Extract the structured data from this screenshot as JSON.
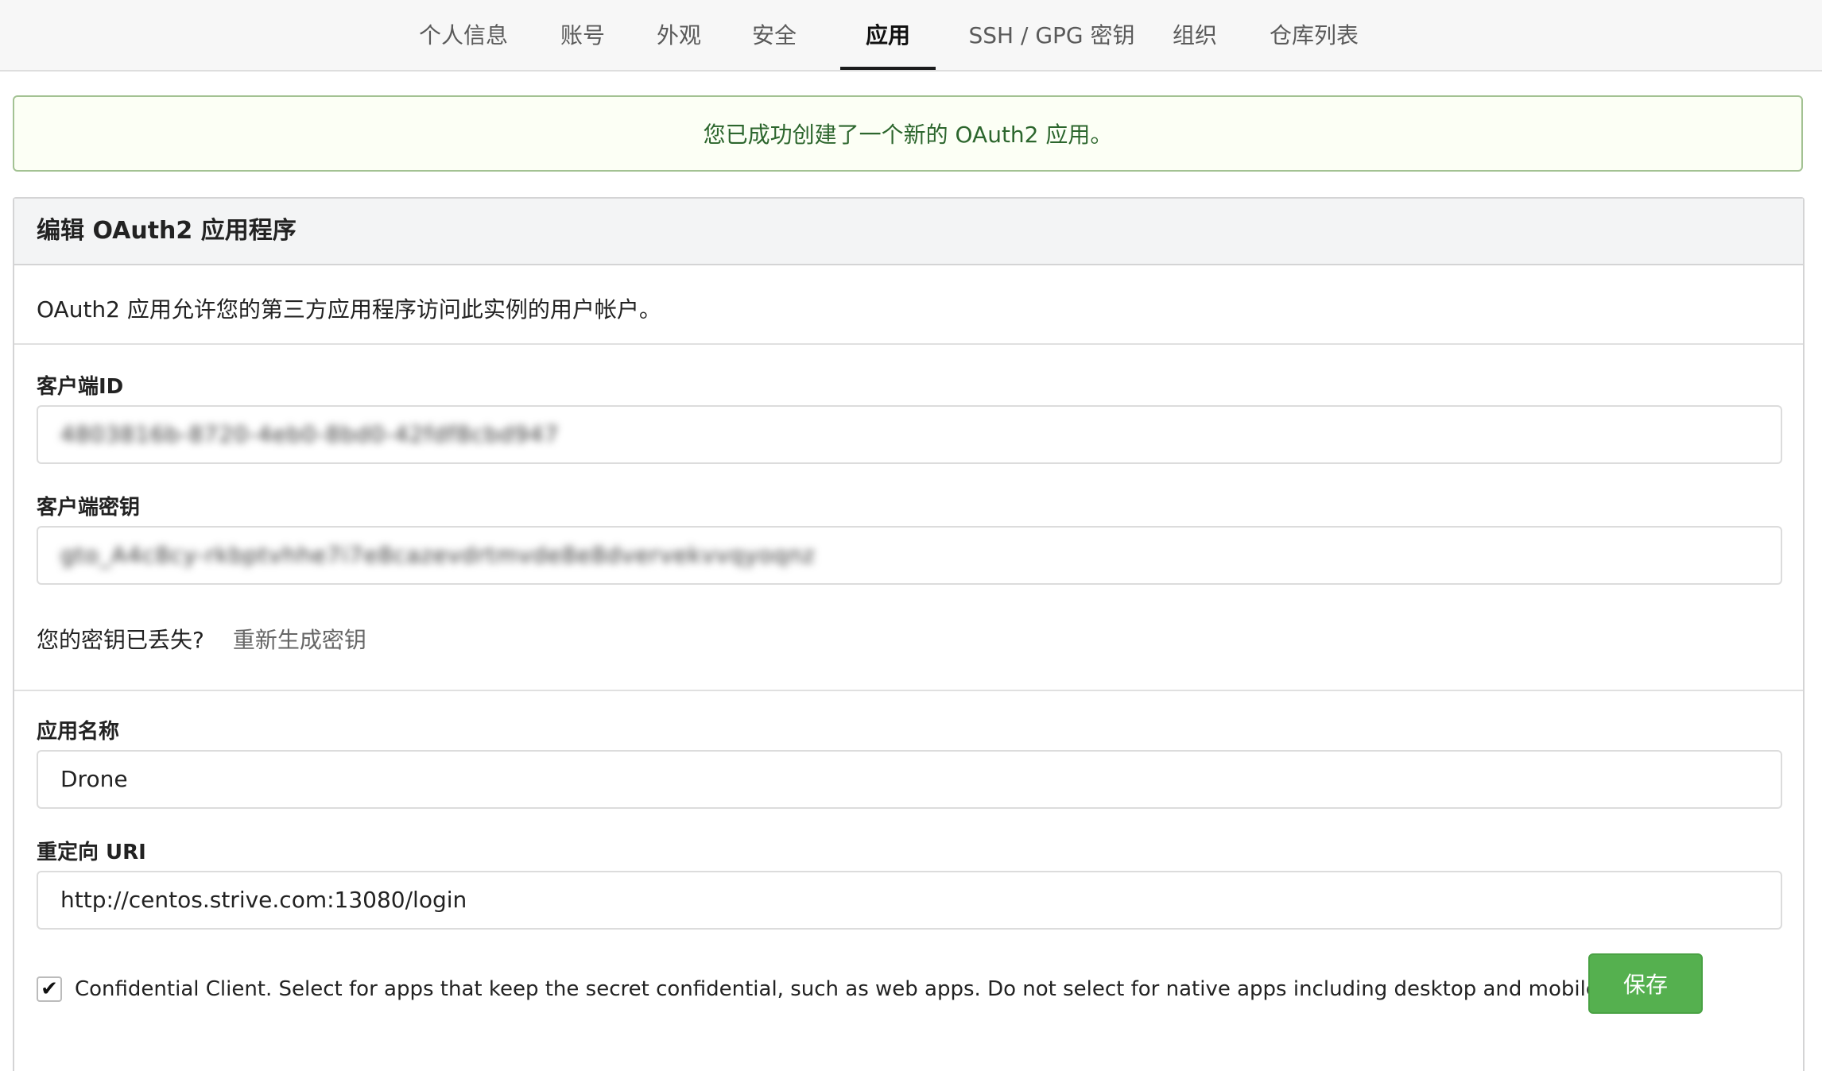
{
  "nav": {
    "tabs": [
      {
        "label": "个人信息",
        "active": false
      },
      {
        "label": "账号",
        "active": false
      },
      {
        "label": "外观",
        "active": false
      },
      {
        "label": "安全",
        "active": false
      },
      {
        "label": "应用",
        "active": true
      },
      {
        "label": "SSH / GPG 密钥",
        "active": false
      },
      {
        "label": "组织",
        "active": false
      },
      {
        "label": "仓库列表",
        "active": false
      }
    ]
  },
  "message": {
    "text": "您已成功创建了一个新的 OAuth2 应用。",
    "type": "success"
  },
  "form": {
    "title": "编辑 OAuth2 应用程序",
    "description": "OAuth2 应用允许您的第三方应用程序访问此实例的用户帐户。",
    "client_id": {
      "label": "客户端ID",
      "value": "4803816b-8720-4eb0-8bd0-42fdf8cbd947"
    },
    "client_secret": {
      "label": "客户端密钥",
      "value": "gto_A4c8cy-rkbptvhhe7i7e8cazevdrtmvde8e8dvervekvvqyoqnz"
    },
    "lost_secret": {
      "text": "您的密钥已丢失?",
      "link": "重新生成密钥"
    },
    "app_name": {
      "label": "应用名称",
      "value": "Drone"
    },
    "redirect_uri": {
      "label": "重定向 URI",
      "value": "http://centos.strive.com:13080/login"
    },
    "confidential": {
      "checked": true,
      "label": "Confidential Client. Select for apps that keep the secret confidential, such as web apps. Do not select for native apps including desktop and mobile apps."
    },
    "save_label": "保存"
  },
  "colors": {
    "success_text": "#2c662d",
    "success_border": "#a3c293",
    "save_button": "#55b04f",
    "active_tab_underline": "#1b1c1d"
  },
  "icons": {
    "checkbox_mark": "check-icon"
  }
}
